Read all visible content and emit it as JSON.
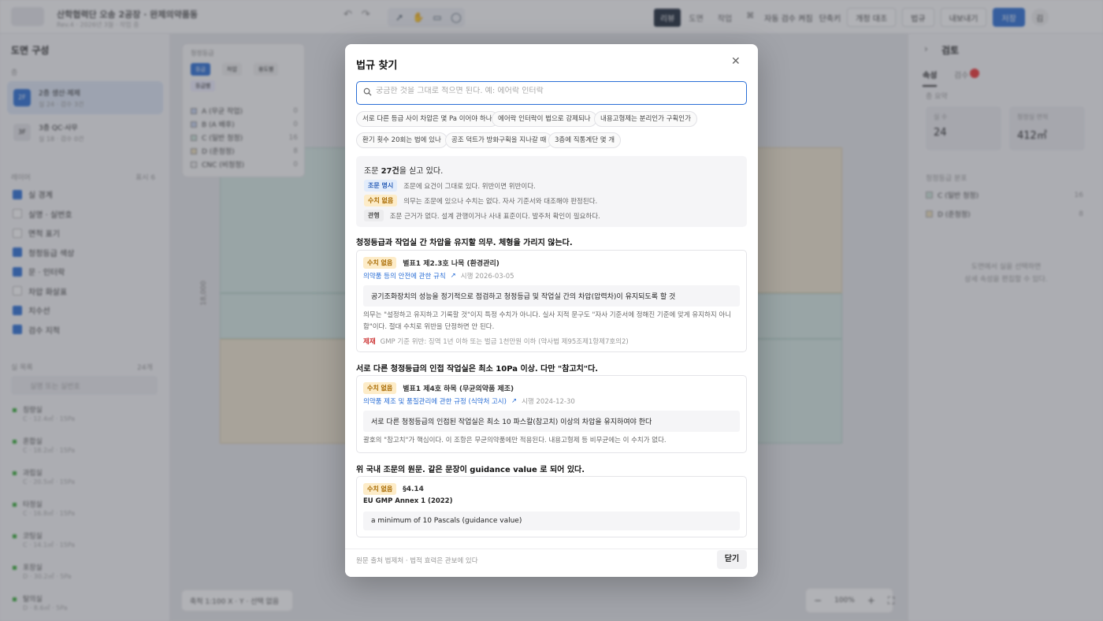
{
  "app": {
    "title": "산학협력단 오송 2공장 · 완제의약품동",
    "subtitle": "Rev.4 · 2026년 3월 · 작업 중",
    "mode_tabs": [
      "리뷰",
      "도면",
      "작업",
      "⌘"
    ],
    "autocheck": "자동 검수 켜짐",
    "shortcut": "단축키",
    "buttons": {
      "compare": "개정 대조",
      "law": "법규",
      "export": "내보내기",
      "save": "저장"
    },
    "user": "김"
  },
  "left_panel": {
    "title": "도면 구성",
    "floor_label": "층",
    "floors": [
      {
        "badge": "2F",
        "name": "2층 생산·제제",
        "meta": "실 24 · 검수 3건"
      },
      {
        "badge": "3F",
        "name": "3층 QC·사무",
        "meta": "실 18 · 검수 0건"
      }
    ],
    "layers_label": "레이어",
    "layers_meta": "표시 6",
    "layers": [
      {
        "name": "실 경계",
        "on": true
      },
      {
        "name": "실명 · 실번호",
        "on": false
      },
      {
        "name": "면적 표기",
        "on": false
      },
      {
        "name": "청정등급 색상",
        "on": true
      },
      {
        "name": "문 · 인터락",
        "on": true
      },
      {
        "name": "차압 화살표",
        "on": false
      },
      {
        "name": "치수선",
        "on": true
      },
      {
        "name": "검수 지적",
        "on": true
      }
    ],
    "rooms_label": "실 목록",
    "rooms_meta": "24개",
    "room_search_placeholder": "실명 또는 실번호",
    "rooms": [
      {
        "name": "칭량실",
        "meta": "C · 12.4㎡ · 15Pa"
      },
      {
        "name": "혼합실",
        "meta": "C · 18.2㎡ · 15Pa"
      },
      {
        "name": "과립실",
        "meta": "C · 20.5㎡ · 15Pa"
      },
      {
        "name": "타정실",
        "meta": "C · 16.8㎡ · 15Pa"
      },
      {
        "name": "코팅실",
        "meta": "C · 14.1㎡ · 15Pa"
      },
      {
        "name": "포장실",
        "meta": "D · 30.2㎡ · 5Pa"
      },
      {
        "name": "탈의실",
        "meta": "D · 8.6㎡ · 5Pa"
      }
    ]
  },
  "canvas": {
    "legend_title": "청정등급",
    "legend_tabs": [
      "등급",
      "차압",
      "용도별"
    ],
    "legend_sel": "등급별",
    "legend": [
      {
        "name": "A (무균 작업)",
        "count": "0",
        "color": "#c7d4f0"
      },
      {
        "name": "B (A 배후)",
        "count": "0",
        "color": "#c7d4f0"
      },
      {
        "name": "C (일반 청정)",
        "count": "16",
        "color": "#cfe6dc"
      },
      {
        "name": "D (준청정)",
        "count": "8",
        "color": "#efe1bd"
      },
      {
        "name": "CNC (비청정)",
        "count": "0",
        "color": "#eeeeee"
      }
    ],
    "dim_label": "18,000",
    "status": {
      "scale": "축척 1:100",
      "xy": "X · Y ·",
      "sel": "선택 없음"
    },
    "zoom": "100%"
  },
  "right_panel": {
    "title": "검토",
    "tabs": [
      "속성",
      "검수"
    ],
    "summary_label": "층 요약",
    "cards": [
      {
        "k": "실 수",
        "v": "24"
      },
      {
        "k": "청정실 면적",
        "v": "412㎡"
      }
    ],
    "dist_label": "청정등급 분포",
    "dist": [
      {
        "name": "C (일반 청정)",
        "count": "16",
        "color": "#cfe6dc"
      },
      {
        "name": "D (준청정)",
        "count": "8",
        "color": "#efe1bd"
      }
    ],
    "hint1": "도면에서 실을 선택하면",
    "hint2": "상세 속성을 편집할 수 있다."
  },
  "modal": {
    "title": "법규 찾기",
    "search_placeholder": "궁금한 것을 그대로 적으면 된다. 예: 에어락 인터락",
    "chips": [
      "서로 다른 등급 사이 차압은 몇 Pa 이어야 하나",
      "에어락 인터락이 법으로 강제되나",
      "내용고형제는 분리인가 구획인가",
      "환기 횟수 20회는 법에 있나",
      "공조 덕트가 방화구획을 지나갈 때",
      "3층에 직통계단 몇 개"
    ],
    "summary": {
      "prefix": "조문 ",
      "count": "27건",
      "suffix": "을 싣고 있다.",
      "rows": [
        {
          "tag": "조문 명시",
          "text": "조문에 요건이 그대로 있다. 위반이면 위반이다."
        },
        {
          "tag": "수치 없음",
          "text": "의무는 조문에 있으나 수치는 없다. 자사 기준서와 대조해야 판정된다."
        },
        {
          "tag": "관행",
          "text": "조문 근거가 없다. 설계 관행이거나 사내 표준이다. 발주처 확인이 필요하다."
        }
      ]
    },
    "sections": [
      {
        "title": "청정등급과 작업실 간 차압을 유지할 의무. 체형을 가리지 않는다.",
        "tag": "수치 없음",
        "ref": "별표1 제2.3호 나목 (환경관리)",
        "law": "의약품 등의 안전에 관한 규칙",
        "date": "시행 2026-03-05",
        "quote": "공기조화장치의 성능을 정기적으로 점검하고 청정등급 및 작업실 간의 차압(압력차)이 유지되도록 할 것",
        "note": "의무는 \"설정하고 유지하고 기록할 것\"이지 특정 수치가 아니다. 실사 지적 문구도 \"자사 기준서에 정해진 기준에 맞게 유지하지 아니함\"이다. 절대 수치로 위반을 단정하면 안 된다.",
        "penalty_label": "제재",
        "penalty": "GMP 기준 위반: 징역 1년 이하 또는 벌금 1천만원 이하 (약사법 제95조제1항제7호의2)"
      },
      {
        "title": "서로 다른 청정등급의 인접 작업실은 최소 10Pa 이상. 다만 \"참고치\"다.",
        "tag": "수치 없음",
        "ref": "별표1 제4호 하목 (무균의약품 제조)",
        "law": "의약품 제조 및 품질관리에 관한 규정 (식약처 고시)",
        "date": "시행 2024-12-30",
        "quote": "서로 다른 청정등급의 인접된 작업실은 최소 10 파스칼(참고치) 이상의 차압을 유지하여야 한다",
        "note": "괄호의 \"참고치\"가 핵심이다. 이 조항은 무균의약품에만 적용된다. 내용고형제 등 비무균에는 이 수치가 없다."
      },
      {
        "title": "위 국내 조문의 원문. 같은 문장이 guidance value 로 되어 있다.",
        "tag": "수치 없음",
        "ref": "§4.14",
        "law": "EU GMP Annex 1 (2022)",
        "quote": "a minimum of 10 Pascals (guidance value)"
      }
    ],
    "footer_note": "원문 출처 법제처 · 법적 효력은 관보에 있다",
    "close_label": "닫기"
  }
}
